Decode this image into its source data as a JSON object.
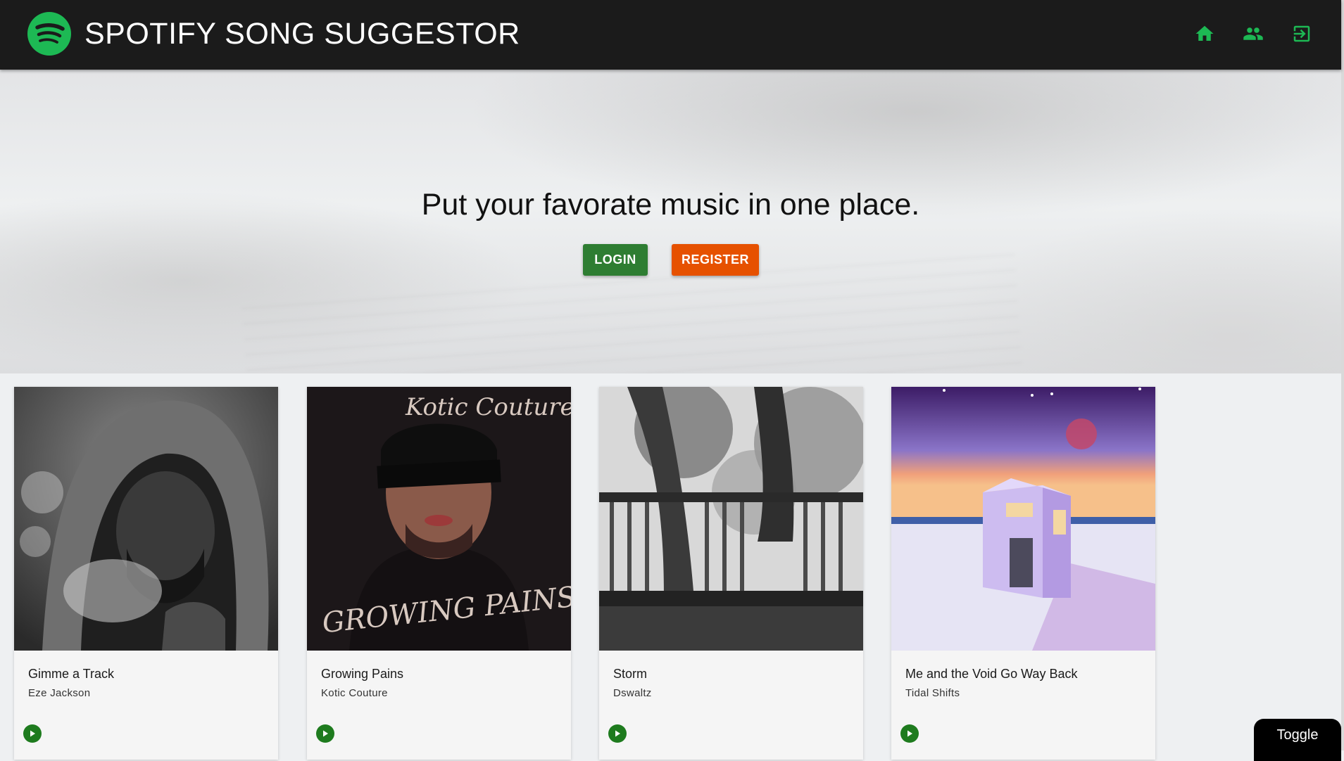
{
  "header": {
    "title": "SPOTIFY SONG SUGGESTOR",
    "logo_icon": "spotify-logo",
    "nav": [
      {
        "icon": "home-icon",
        "label": "Home"
      },
      {
        "icon": "people-icon",
        "label": "Users"
      },
      {
        "icon": "login-icon",
        "label": "Sign in"
      }
    ]
  },
  "hero": {
    "headline": "Put your favorate music in one place.",
    "login_label": "LOGIN",
    "register_label": "REGISTER"
  },
  "cards": [
    {
      "title": "Gimme a Track",
      "artist": "Eze Jackson"
    },
    {
      "title": "Growing Pains",
      "artist": "Kotic Couture",
      "cover_text_top": "Kotic Couture",
      "cover_text_bottom": "GROWING PAINS"
    },
    {
      "title": "Storm",
      "artist": "Dswaltz"
    },
    {
      "title": "Me and the Void Go Way Back",
      "artist": "Tidal Shifts"
    }
  ],
  "toggle_label": "Toggle",
  "colors": {
    "appbar": "#1b1b1b",
    "accent_green": "#1db954",
    "login_button": "#2e7d32",
    "register_button": "#e65100",
    "play_button": "#1e7b1e"
  }
}
